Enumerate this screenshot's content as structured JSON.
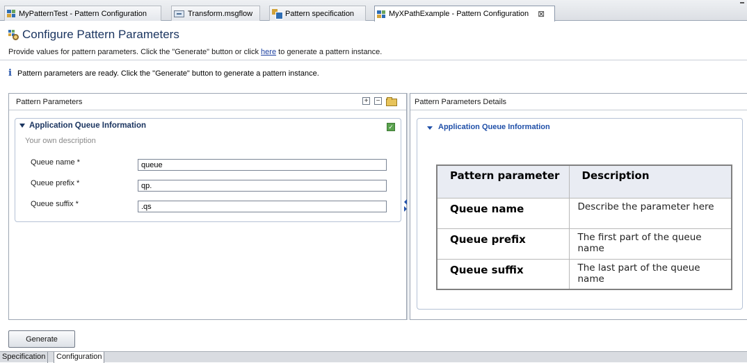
{
  "editor_tabs": [
    {
      "label": "MyPatternTest - Pattern Configuration",
      "icon": "pattern-icon"
    },
    {
      "label": "Transform.msgflow",
      "icon": "msgflow-icon"
    },
    {
      "label": "Pattern specification",
      "icon": "pattern-spec-icon"
    },
    {
      "label": "MyXPathExample - Pattern Configuration",
      "icon": "pattern-icon",
      "active": true,
      "close": "⊠"
    }
  ],
  "form": {
    "title": "Configure Pattern Parameters",
    "desc_before": "Provide values for pattern parameters. Click the \"Generate\" button or click ",
    "desc_link": "here",
    "desc_after": " to generate a pattern instance.",
    "info_icon": "i",
    "info_message": "Pattern parameters are ready. Click the \"Generate\" button to generate a pattern instance."
  },
  "left_pane": {
    "header": "Pattern Parameters",
    "expand_all": "+",
    "collapse_all": "−",
    "section": {
      "title": "Application Queue Information",
      "description": "Your own description",
      "fields": [
        {
          "label": "Queue name *",
          "value": "queue"
        },
        {
          "label": "Queue prefix *",
          "value": "qp."
        },
        {
          "label": "Queue suffix *",
          "value": ".qs"
        }
      ]
    }
  },
  "right_pane": {
    "header": "Pattern Parameters Details",
    "section_title": "Application Queue Information",
    "table": {
      "headers": [
        "Pattern parameter",
        "Description"
      ],
      "rows": [
        {
          "param": "Queue name",
          "desc": "Describe the parameter here"
        },
        {
          "param": "Queue prefix",
          "desc": "The first part of the queue name"
        },
        {
          "param": "Queue suffix",
          "desc": "The last part of the queue name"
        }
      ]
    }
  },
  "generate_button": "Generate",
  "bottom_tabs": [
    {
      "label": "Specification"
    },
    {
      "label": "Configuration",
      "active": true
    }
  ],
  "colors": {
    "title_blue": "#1b3560",
    "link_blue": "#1f4fa8",
    "check_green": "#5aa24e"
  }
}
